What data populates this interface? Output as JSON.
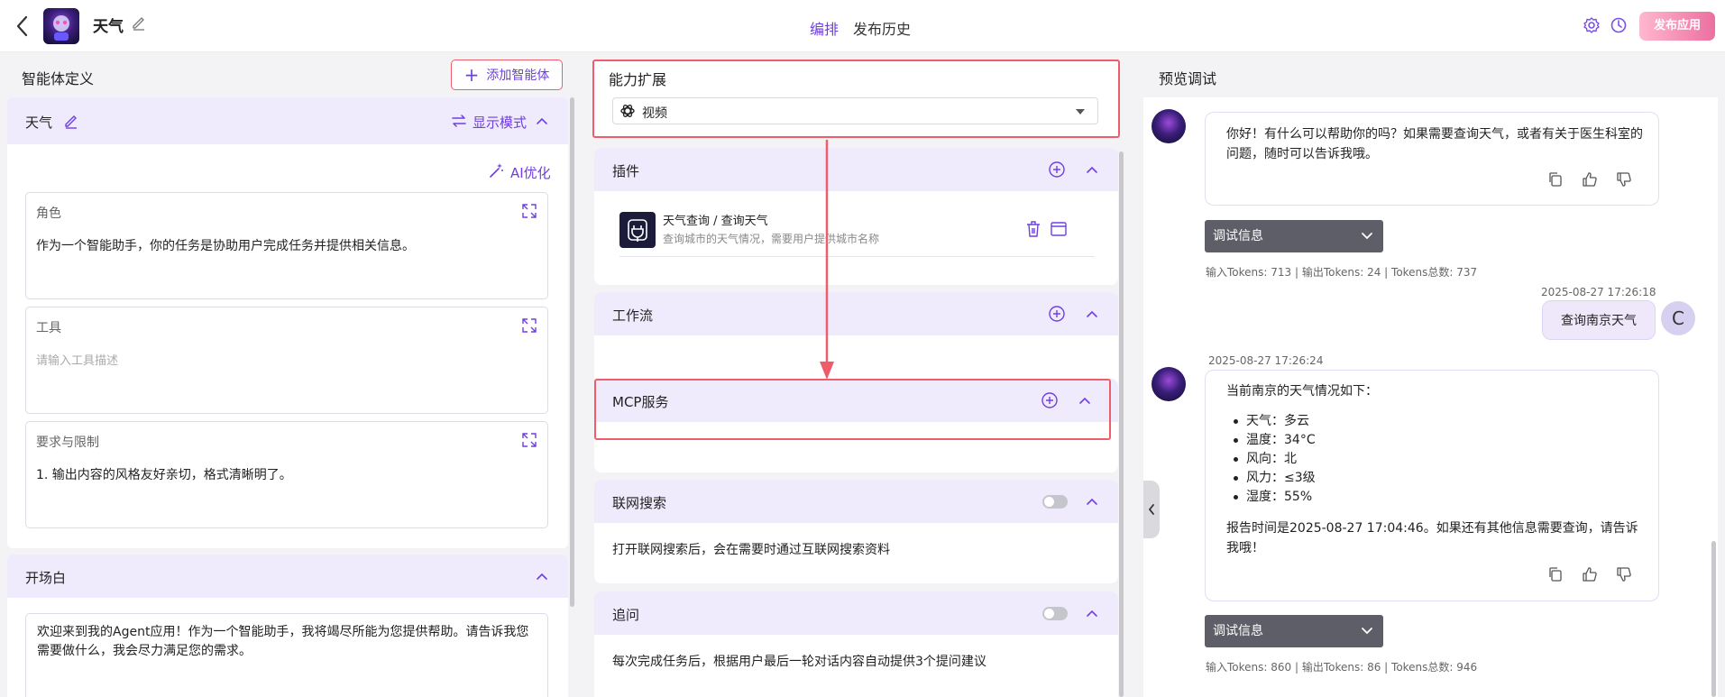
{
  "topbar": {
    "app_name": "天气",
    "tabs": [
      {
        "label": "编排",
        "active": true
      },
      {
        "label": "发布历史",
        "active": false
      }
    ],
    "publish_label": "发布应用",
    "accent_color": "#6f3fe0"
  },
  "left": {
    "title": "智能体定义",
    "add_agent_label": "添加智能体",
    "agent": {
      "name": "天气",
      "mode_label": "显示模式",
      "ai_optimize_label": "AI优化",
      "role": {
        "label": "角色",
        "value": "作为一个智能助手，你的任务是协助用户完成任务并提供相关信息。"
      },
      "tool": {
        "label": "工具",
        "placeholder": "请输入工具描述"
      },
      "requirements": {
        "label": "要求与限制",
        "value": "1.  输出内容的风格友好亲切，格式清晰明了。"
      }
    },
    "opening": {
      "title": "开场白",
      "text": "欢迎来到我的Agent应用！作为一个智能助手，我将竭尽所能为您提供帮助。请告诉我您需要做什么，我会尽力满足您的需求。"
    }
  },
  "middle": {
    "title": "能力扩展",
    "model_select": {
      "value": "视频"
    },
    "plugin": {
      "title": "插件",
      "item": {
        "name": "天气查询 / 查询天气",
        "desc": "查询城市的天气情况，需要用户提供城市名称"
      }
    },
    "workflow": {
      "title": "工作流"
    },
    "mcp": {
      "title": "MCP服务"
    },
    "web_search": {
      "title": "联网搜索",
      "enabled": false,
      "desc": "打开联网搜索后，会在需要时通过互联网搜索资料"
    },
    "follow_up": {
      "title": "追问",
      "enabled": false,
      "desc": "每次完成任务后，根据用户最后一轮对话内容自动提供3个提问建议"
    }
  },
  "preview": {
    "title": "预览调试",
    "bot_msg1": "你好！有什么可以帮助你的吗？如果需要查询天气，或者有关于医生科室的问题，随时可以告诉我哦。",
    "debug_label": "调试信息",
    "tokens1": "输入Tokens: 713 |  输出Tokens: 24 |  Tokens总数: 737",
    "user_time": "2025-08-27 17:26:18",
    "user_msg": "查询南京天气",
    "user_initial": "C",
    "bot_time2": "2025-08-27 17:26:24",
    "bot_msg2_intro": "当前南京的天气情况如下：",
    "weather": [
      "天气：多云",
      "温度：34°C",
      "风向：北",
      "风力：≤3级",
      "湿度：55%"
    ],
    "bot_msg2_outro": "报告时间是2025-08-27 17:04:46。如果还有其他信息需要查询，请告诉我哦！",
    "tokens2": "输入Tokens: 860 |  输出Tokens: 86 |  Tokens总数: 946"
  }
}
